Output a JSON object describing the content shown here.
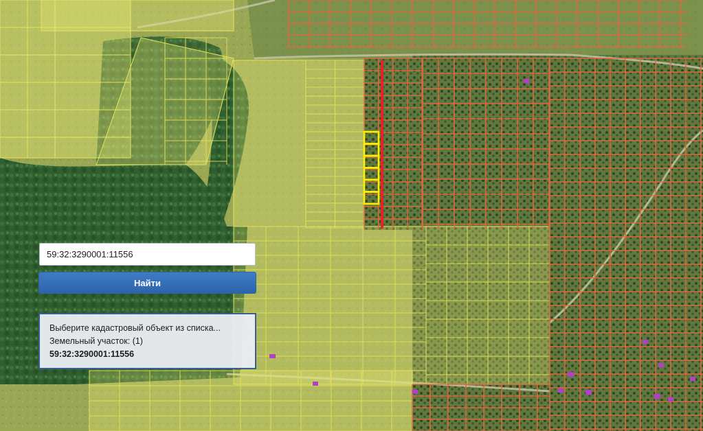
{
  "search": {
    "value": "59:32:3290001:11556",
    "button_label": "Найти"
  },
  "results": {
    "prompt": "Выберите кадастровый объект из списка...",
    "category": "Земельный участок: (1)",
    "items": [
      "59:32:3290001:11556"
    ]
  },
  "colors": {
    "cadastral_owned": "#e06a3c",
    "cadastral_free": "#f2ee4a",
    "selected_parcel": "#ffee00",
    "highlight_boundary": "#e0242a",
    "accent_button": "#3470b8"
  },
  "icons": [
    "building-marker-icon"
  ]
}
